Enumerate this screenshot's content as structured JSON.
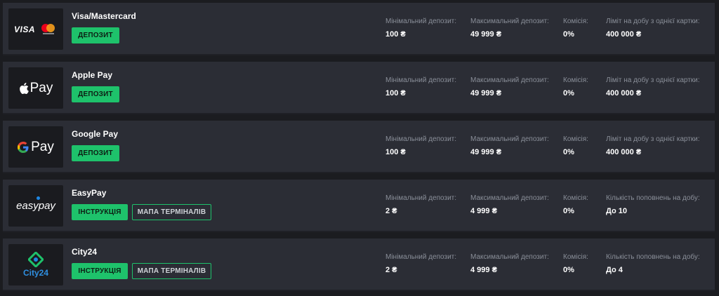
{
  "labels": {
    "min_deposit": "Мінімальний депозит:",
    "max_deposit": "Максимальний депозит:",
    "commission": "Комісія:",
    "card_limit": "Ліміт на добу з однієї картки:",
    "topups_per_day": "Кількість поповнень на добу:"
  },
  "rows": [
    {
      "name": "Visa/Mastercard",
      "logo_text": "VISA",
      "button": "Депозит",
      "min": "100 ₴",
      "max": "49 999 ₴",
      "commission": "0%",
      "limit": "400 000 ₴"
    },
    {
      "name": "Apple Pay",
      "logo_text": "Pay",
      "button": "Депозит",
      "min": "100 ₴",
      "max": "49 999 ₴",
      "commission": "0%",
      "limit": "400 000 ₴"
    },
    {
      "name": "Google Pay",
      "logo_text": "Pay",
      "button": "Депозит",
      "min": "100 ₴",
      "max": "49 999 ₴",
      "commission": "0%",
      "limit": "400 000 ₴"
    },
    {
      "name": "EasyPay",
      "logo_text": "easypay",
      "button": "Інструкція",
      "button2": "Мапа терміналів",
      "min": "2 ₴",
      "max": "4 999 ₴",
      "commission": "0%",
      "limit": "До 10"
    },
    {
      "name": "City24",
      "logo_text": "City24",
      "button": "Інструкція",
      "button2": "Мапа терміналів",
      "min": "2 ₴",
      "max": "4 999 ₴",
      "commission": "0%",
      "limit": "До 4"
    }
  ],
  "colors": {
    "accent": "#1ec26b",
    "row_bg": "#2b2d35",
    "page_bg": "#1b1c20",
    "label": "#8a8f99"
  },
  "icons": [
    "visa-mastercard-logo",
    "apple-icon",
    "google-g-icon",
    "easypay-logo",
    "city24-logo"
  ]
}
